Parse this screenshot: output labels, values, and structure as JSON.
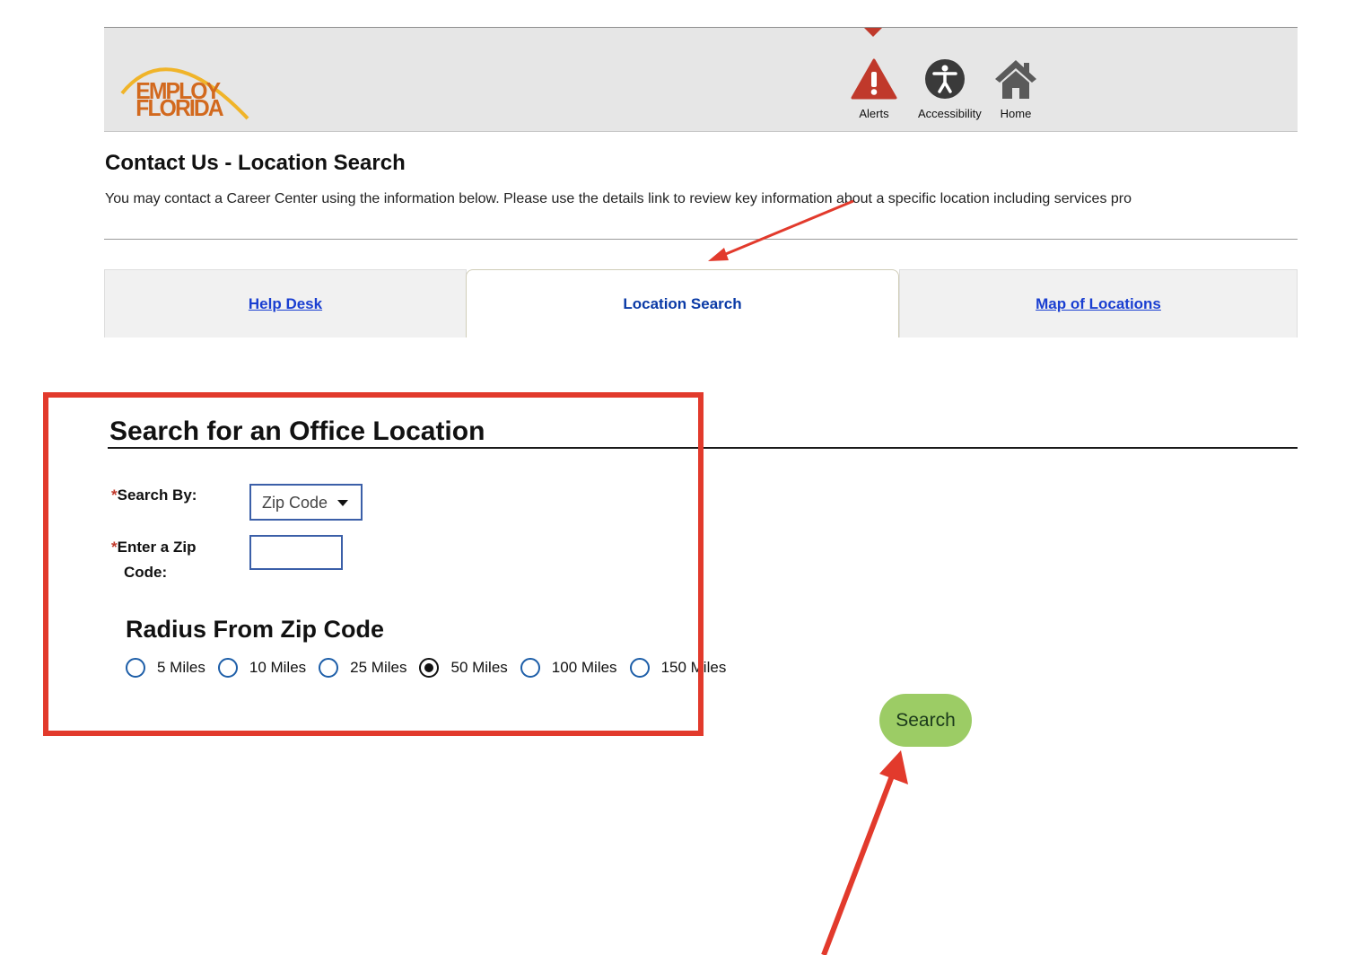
{
  "header": {
    "logo_text": "EMPLOY FLORIDA",
    "icons": [
      {
        "label": "Alerts",
        "icon": "alert-triangle-icon"
      },
      {
        "label": "Accessibility",
        "icon": "accessibility-icon"
      },
      {
        "label": "Home",
        "icon": "home-icon"
      }
    ]
  },
  "page": {
    "title": "Contact Us - Location Search",
    "intro": "You may contact a Career Center using the information below. Please use the details link to review key information about a specific location including services pro"
  },
  "tabs": [
    {
      "label": "Help Desk",
      "active": false
    },
    {
      "label": "Location Search",
      "active": true
    },
    {
      "label": "Map of Locations",
      "active": false
    }
  ],
  "form": {
    "section_title": "Search for an Office Location",
    "search_by_label": "Search By:",
    "search_by_value": "Zip Code",
    "zip_label_line1": "Enter a Zip",
    "zip_label_line2": "Code:",
    "zip_value": "",
    "required_mark": "*",
    "radius_title": "Radius From Zip Code",
    "radius_options": [
      {
        "label": "5 Miles",
        "checked": false
      },
      {
        "label": "10 Miles",
        "checked": false
      },
      {
        "label": "25 Miles",
        "checked": false
      },
      {
        "label": "50 Miles",
        "checked": true
      },
      {
        "label": "100 Miles",
        "checked": false
      },
      {
        "label": "150 Miles",
        "checked": false
      }
    ],
    "search_button": "Search"
  },
  "colors": {
    "annotation_red": "#e23a2c",
    "search_button_bg": "#9ccc65",
    "link_blue": "#1a3fd1",
    "alert_red": "#c0392b"
  }
}
